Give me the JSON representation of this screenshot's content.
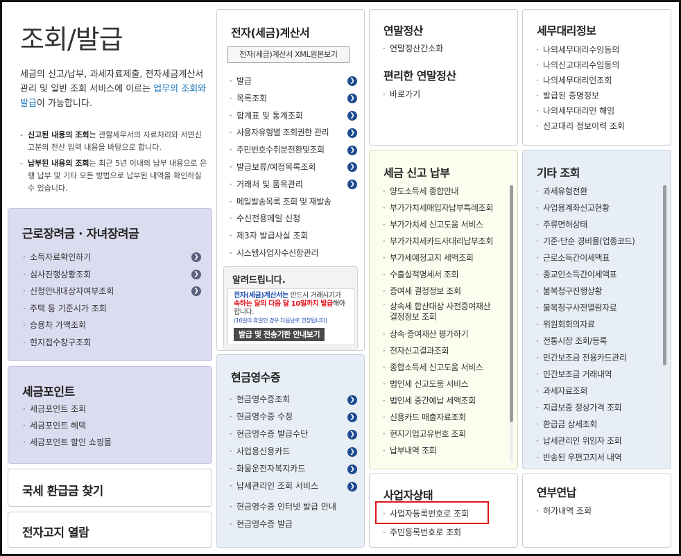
{
  "intro": {
    "title": "조회/발급",
    "desc_before": "세금의 신고/납부, 과세자료제출, 전자세금계산서 관리 및 일반 조회 서비스에 이르는 ",
    "desc_highlight": "업무의 조회와 발급",
    "desc_after": "이 가능합니다.",
    "note1_strong": "신고된 내용의 조회",
    "note1_rest": "는 관할세무서의 자료처리와 서면신고분의 전산 입력 내용을 바탕으로 합니다.",
    "note2_strong": "납부된 내용의 조회",
    "note2_rest": "는 최근 5년 이내의 납부 내용으로 은행 납부 및 기타 모든 방법으로 납부된 내역을 확인하실 수 있습니다."
  },
  "labor": {
    "title": "근로장려금 · 자녀장려금",
    "items": [
      "소득자료확인하기",
      "심사진행상황조회",
      "신청안내대상자여부조회",
      "주택 등 기준시가 조회",
      "승용차 가액조회",
      "현지접수창구조회"
    ]
  },
  "tax_point": {
    "title": "세금포인트",
    "items": [
      "세금포인트 조회",
      "세금포인트 혜택",
      "세금포인트 할인 쇼핑몰"
    ]
  },
  "refund": {
    "label": "국세 환급금 찾기"
  },
  "e_notice": {
    "label": "전자고지 열람"
  },
  "einvoice": {
    "title": "전자(세금)계산서",
    "xml_button": "전자(세금)계산서 XML원본보기",
    "items": [
      "발급",
      "목록조회",
      "합계표 및 통계조회",
      "사용자유형별 조회권한 관리",
      "주민번호수취분전환및조회",
      "발급보류/예정목록조회",
      "거래처 및 품목관리",
      "메일발송목록 조회 및 재발송",
      "수신전용메일 신청",
      "제3자 발급사실 조회",
      "시스템사업자수신함관리"
    ]
  },
  "notice": {
    "title": "알려드립니다.",
    "line1_red": "전자(세금)계산서는",
    "line1_rest": " 반드시 거래시기가",
    "line2_red": "속하는 달의 다음 달 10일까지 발급",
    "line2_rest": "해야",
    "line3": "합니다.",
    "small": "(10일이 휴일인 경우 다음날로 연장됩니다)",
    "button": "발급 및 전송기한 안내보기"
  },
  "cash": {
    "title": "현금영수증",
    "items": [
      "현금영수증조회",
      "현금영수증 수정",
      "현금영수증 발급수단",
      "사업용신용카드",
      "화물운전자복지카드",
      "납세관리인 조회 서비스"
    ],
    "extra": [
      "현금영수증 인터넷 발급 안내",
      "현금영수증 발급"
    ]
  },
  "year_end": {
    "title": "연말정산",
    "items": [
      "연말정산간소화"
    ],
    "title2": "편리한 연말정산",
    "items2": [
      "바로가기"
    ]
  },
  "agent": {
    "title": "세무대리정보",
    "items": [
      "나의세무대리수임동의",
      "나의신고대리수임동의",
      "나의세무대리인조회",
      "발급된 증명정보",
      "나의세무대리인 해임",
      "신고대리 정보이력 조회"
    ]
  },
  "filing": {
    "title": "세금 신고 납부",
    "items": [
      [
        "양도소득세 종합안내"
      ],
      [
        "부가가치세매입자납부특례조회"
      ],
      [
        "부가가치세 신고도움 서비스"
      ],
      [
        "부가가치세카드사대리납부조회"
      ],
      [
        "부가세예정고지 세액조회"
      ],
      [
        "수출실적명세서 조회"
      ],
      [
        "증여세 결정정보 조회"
      ],
      [
        "상속세 합산대상 사전증여재산",
        "결정정보 조회"
      ],
      [
        "상속·증여재산 평가하기"
      ],
      [
        "전자신고결과조회"
      ],
      [
        "종합소득세 신고도움 서비스"
      ],
      [
        "법인세 신고도움 서비스"
      ],
      [
        "법인세 중간예납 세액조회"
      ],
      [
        "신용카드 매출자료조회"
      ],
      [
        "현지기업고유번호 조회"
      ],
      [
        "납부내역 조회"
      ]
    ]
  },
  "other": {
    "title": "기타 조회",
    "items": [
      "과세유형전환",
      "사업용계좌신고현황",
      "주류면허상태",
      "기준·단순 경비율(업종코드)",
      "근로소득간이세액표",
      "종교인소득간이세액표",
      "불복청구진행상황",
      "불복청구사전열람자료",
      "위원회회의자료",
      "전통시장 조회/등록",
      "민간보조금 전용카드관리",
      "민간보조금 거래내역",
      "과세자료조회",
      "지급보증 정상가격 조회",
      "환급금 상세조회",
      "납세관리인 위임자 조회",
      "반송된 우편고지서 내역"
    ]
  },
  "business": {
    "title": "사업자상태",
    "highlight_color": "#e0121b",
    "items": [
      "사업자등록번호로 조회",
      "주민등록번호로 조회"
    ]
  },
  "extension": {
    "title": "연부연납",
    "items": [
      "허가내역 조회"
    ]
  }
}
